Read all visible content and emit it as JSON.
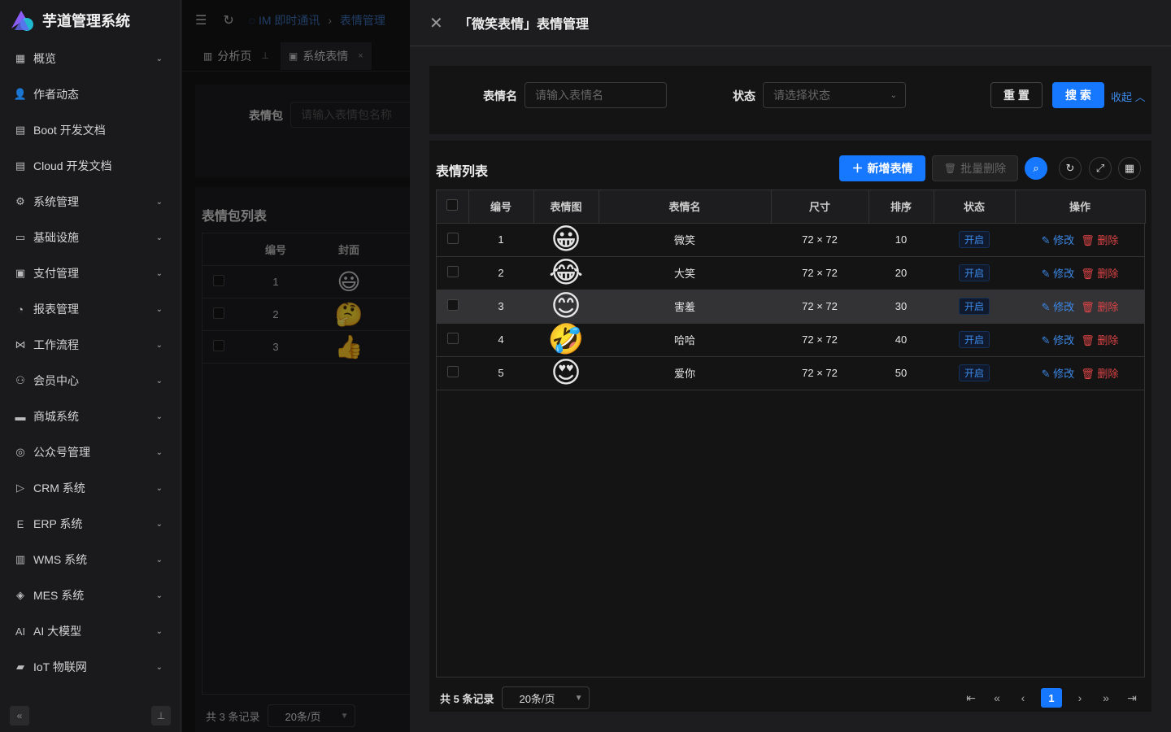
{
  "app": {
    "title": "芋道管理系统"
  },
  "sidebar": {
    "items": [
      {
        "label": "概览",
        "icon": "grid-icon",
        "glyph": "▦",
        "has_children": true
      },
      {
        "label": "作者动态",
        "icon": "user-icon",
        "glyph": "👤",
        "has_children": false
      },
      {
        "label": "Boot 开发文档",
        "icon": "document-icon",
        "glyph": "▤",
        "has_children": false
      },
      {
        "label": "Cloud 开发文档",
        "icon": "document-icon",
        "glyph": "▤",
        "has_children": false
      },
      {
        "label": "系统管理",
        "icon": "gear-icon",
        "glyph": "⚙",
        "has_children": true
      },
      {
        "label": "基础设施",
        "icon": "monitor-icon",
        "glyph": "▭",
        "has_children": true
      },
      {
        "label": "支付管理",
        "icon": "payment-icon",
        "glyph": "▣",
        "has_children": true
      },
      {
        "label": "报表管理",
        "icon": "pie-chart-icon",
        "glyph": "◔",
        "has_children": true
      },
      {
        "label": "工作流程",
        "icon": "workflow-icon",
        "glyph": "⋈",
        "has_children": true
      },
      {
        "label": "会员中心",
        "icon": "members-icon",
        "glyph": "⚇",
        "has_children": true
      },
      {
        "label": "商城系统",
        "icon": "shop-icon",
        "glyph": "▬",
        "has_children": true
      },
      {
        "label": "公众号管理",
        "icon": "compass-icon",
        "glyph": "◎",
        "has_children": true
      },
      {
        "label": "CRM 系统",
        "icon": "crm-icon",
        "glyph": "▷",
        "has_children": true
      },
      {
        "label": "ERP 系统",
        "icon": "erp-icon",
        "glyph": "E",
        "has_children": true
      },
      {
        "label": "WMS 系统",
        "icon": "warehouse-icon",
        "glyph": "▥",
        "has_children": true
      },
      {
        "label": "MES 系统",
        "icon": "chip-icon",
        "glyph": "◈",
        "has_children": true
      },
      {
        "label": "AI 大模型",
        "icon": "ai-icon",
        "glyph": "AI",
        "has_children": true
      },
      {
        "label": "IoT 物联网",
        "icon": "router-icon",
        "glyph": "▰",
        "has_children": true
      }
    ]
  },
  "header": {
    "breadcrumb_1": "IM 即时通讯",
    "breadcrumb_2": "表情管理"
  },
  "tabs": [
    {
      "label": "分析页"
    },
    {
      "label": "系统表情"
    }
  ],
  "behind": {
    "search_label": "表情包",
    "search_placeholder": "请输入表情包名称",
    "list_title": "表情包列表",
    "col_no": "编号",
    "col_cover": "封面",
    "rows": [
      {
        "no": "1",
        "emoji": "😃"
      },
      {
        "no": "2",
        "emoji": "🤔"
      },
      {
        "no": "3",
        "emoji": "👍"
      }
    ],
    "total": "共 3 条记录",
    "page_size": "20条/页"
  },
  "drawer": {
    "title": "「微笑表情」表情管理",
    "search": {
      "name_label": "表情名",
      "name_placeholder": "请输入表情名",
      "status_label": "状态",
      "status_placeholder": "请选择状态",
      "reset": "重 置",
      "search": "搜 索",
      "collapse": "收起"
    },
    "list": {
      "title": "表情列表",
      "add": "新增表情",
      "batch_delete": "批量删除",
      "columns": [
        "编号",
        "表情图",
        "表情名",
        "尺寸",
        "排序",
        "状态",
        "操作"
      ],
      "rows": [
        {
          "no": "1",
          "emoji": "😀",
          "name": "微笑",
          "size": "72 × 72",
          "sort": "10",
          "status": "开启"
        },
        {
          "no": "2",
          "emoji": "😂",
          "name": "大笑",
          "size": "72 × 72",
          "sort": "20",
          "status": "开启"
        },
        {
          "no": "3",
          "emoji": "😊",
          "name": "害羞",
          "size": "72 × 72",
          "sort": "30",
          "status": "开启"
        },
        {
          "no": "4",
          "emoji": "🤣",
          "name": "哈哈",
          "size": "72 × 72",
          "sort": "40",
          "status": "开启"
        },
        {
          "no": "5",
          "emoji": "😍",
          "name": "爱你",
          "size": "72 × 72",
          "sort": "50",
          "status": "开启"
        }
      ],
      "edit": "修改",
      "delete": "删除",
      "total": "共 5 条记录",
      "page_size": "20条/页",
      "current_page": "1"
    }
  },
  "colors": {
    "primary": "#1677ff",
    "link": "#3c89e8",
    "danger": "#dc4446",
    "background": "#141414"
  }
}
